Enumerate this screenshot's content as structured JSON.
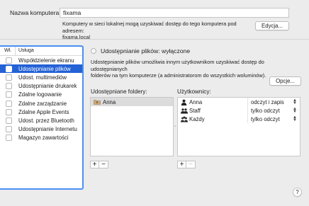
{
  "computer_name": {
    "label": "Nazwa komputera:",
    "value": "fixama",
    "info_line1": "Komputery w sieci lokalnej mogą uzyskiwać dostęp do tego komputera pod adresem:",
    "info_line2": "fixama.local",
    "edit_button": "Edycja..."
  },
  "services": {
    "col_on": "Wł.",
    "col_service": "Usługa",
    "items": [
      {
        "label": "Współdzielenie ekranu",
        "selected": false
      },
      {
        "label": "Udostępnianie plików",
        "selected": true
      },
      {
        "label": "Udost. multimediów",
        "selected": false
      },
      {
        "label": "Udostępnianie drukarek",
        "selected": false
      },
      {
        "label": "Zdalne logowanie",
        "selected": false
      },
      {
        "label": "Zdalne zarządzanie",
        "selected": false
      },
      {
        "label": "Zdalne Apple Events",
        "selected": false
      },
      {
        "label": "Udost. przez Bluetooth",
        "selected": false
      },
      {
        "label": "Udostępnianie Internetu",
        "selected": false
      },
      {
        "label": "Magazyn zawartości",
        "selected": false
      }
    ]
  },
  "detail": {
    "status": "Udostępnianie plików: wyłączone",
    "description_line1": "Udostępnianie plików umożliwia innym użytkownikom uzyskiwać dostęp do udostępnianych",
    "description_line2": "folderów na tym komputerze (a administratorom do wszystkich woluminów).",
    "options_button": "Opcje...",
    "shared_folders_label": "Udostępniane foldery:",
    "users_label": "Użytkownicy:",
    "folders": [
      "Anna"
    ],
    "users": [
      {
        "name": "Anna",
        "permission": "odczyt i zapis",
        "icon": "single-user-icon"
      },
      {
        "name": "Staff",
        "permission": "tylko odczyt",
        "icon": "group-icon"
      },
      {
        "name": "Każdy",
        "permission": "tylko odczyt",
        "icon": "everyone-icon"
      }
    ]
  },
  "controls": {
    "add": "+",
    "remove": "−",
    "help": "?"
  },
  "colors": {
    "selection": "#2462d6",
    "focus_ring": "#4a8ff7"
  }
}
